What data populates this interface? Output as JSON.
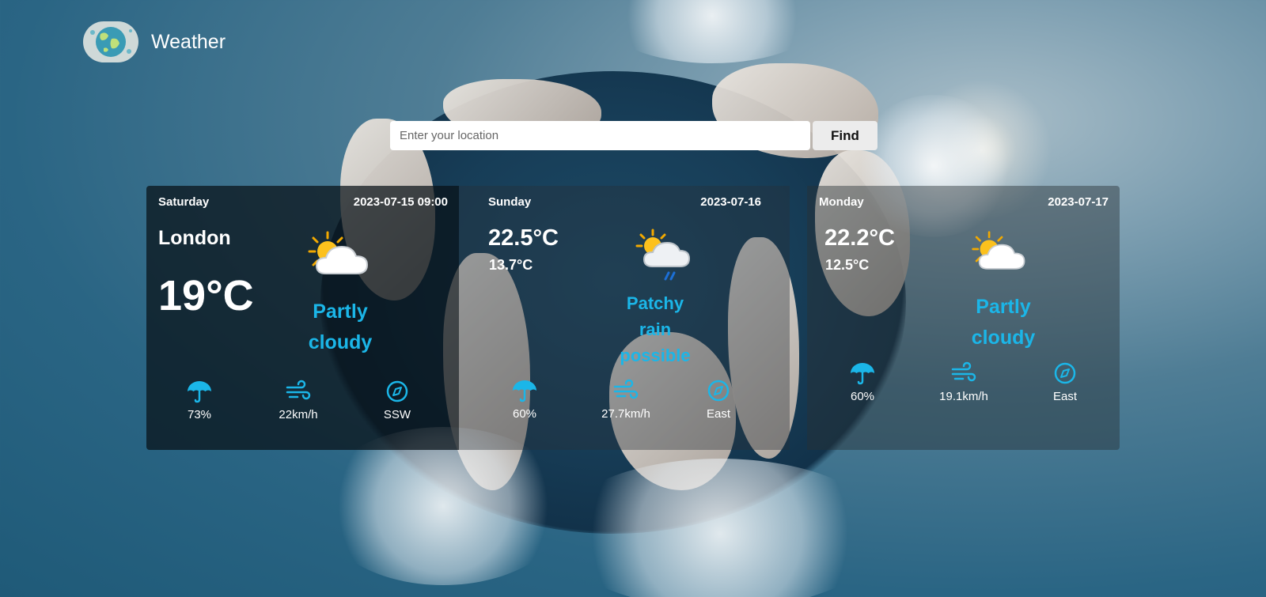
{
  "app": {
    "title": "Weather",
    "logo_icon": "globe-icon"
  },
  "search": {
    "placeholder": "Enter your location",
    "value": "",
    "button_label": "Find"
  },
  "colors": {
    "accent": "#1bb6e8",
    "card_bg": "#0c141a"
  },
  "forecast": [
    {
      "day": "Saturday",
      "date": "2023-07-15 09:00",
      "city": "London",
      "temp": "19°C",
      "condition_line1": "Partly",
      "condition_line2": "cloudy",
      "condition_icon": "partly-cloudy-icon",
      "precipitation": "73%",
      "wind_speed": "22km/h",
      "wind_direction": "SSW"
    },
    {
      "day": "Sunday",
      "date": "2023-07-16",
      "max_temp": "22.5°C",
      "min_temp": "13.7°C",
      "condition_line1": "Patchy",
      "condition_line2": "rain",
      "condition_line3": "possible",
      "condition_icon": "patchy-rain-icon",
      "precipitation": "60%",
      "wind_speed": "27.7km/h",
      "wind_direction": "East"
    },
    {
      "day": "Monday",
      "date": "2023-07-17",
      "max_temp": "22.2°C",
      "min_temp": "12.5°C",
      "condition_line1": "Partly",
      "condition_line2": "cloudy",
      "condition_icon": "partly-cloudy-icon",
      "precipitation": "60%",
      "wind_speed": "19.1km/h",
      "wind_direction": "East"
    }
  ]
}
